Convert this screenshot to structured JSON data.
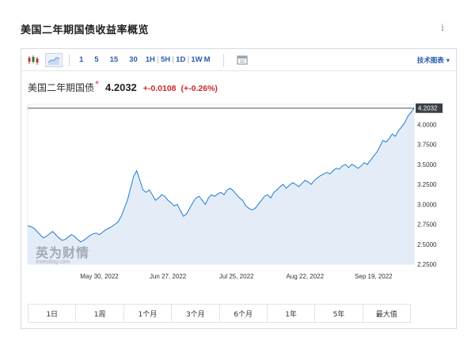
{
  "page": {
    "title": "美国二年期国债收益率概览"
  },
  "toolbar": {
    "intervals": [
      "1",
      "5",
      "15",
      "30",
      "1H",
      "5H",
      "1D",
      "1W",
      "M"
    ],
    "tech_chart_label": "技术图表 ▾"
  },
  "quote": {
    "name": "美国二年期国债",
    "star": "*",
    "price": "4.2032",
    "change": "+-0.0108",
    "change_pct": "(+-0.26%)"
  },
  "watermark": {
    "big": "英为财情",
    "small": "Investing.com"
  },
  "ranges": [
    "1日",
    "1周",
    "1个月",
    "3个月",
    "6个月",
    "1年",
    "5年",
    "最大值"
  ],
  "colors": {
    "line": "#1f7bd1",
    "area": "#e4edf7",
    "down": "#d0282a",
    "link": "#2a5db0"
  },
  "chart_data": {
    "type": "area",
    "title": "",
    "xlabel": "",
    "ylabel": "",
    "ylim": [
      2.25,
      4.25
    ],
    "yticks": [
      2.25,
      2.5,
      2.75,
      3.0,
      3.25,
      3.5,
      3.75,
      4.0
    ],
    "ytick_labels": [
      "2.2500",
      "2.5000",
      "2.7500",
      "3.0000",
      "3.2500",
      "3.5000",
      "3.7500",
      "4.0000"
    ],
    "xticks": [
      {
        "label": "May 30, 2022",
        "index": 23
      },
      {
        "label": "Jun 27, 2022",
        "index": 45
      },
      {
        "label": "Jul 25, 2022",
        "index": 67
      },
      {
        "label": "Aug 22, 2022",
        "index": 89
      },
      {
        "label": "Sep 19, 2022",
        "index": 111
      }
    ],
    "last_value_label": "4.2032",
    "reference_line": 4.2032,
    "values": [
      2.73,
      2.72,
      2.7,
      2.66,
      2.62,
      2.58,
      2.6,
      2.63,
      2.66,
      2.62,
      2.58,
      2.55,
      2.56,
      2.59,
      2.62,
      2.6,
      2.56,
      2.53,
      2.55,
      2.58,
      2.61,
      2.63,
      2.64,
      2.62,
      2.65,
      2.68,
      2.7,
      2.72,
      2.75,
      2.78,
      2.85,
      2.95,
      3.05,
      3.2,
      3.35,
      3.42,
      3.3,
      3.18,
      3.15,
      3.18,
      3.12,
      3.05,
      3.08,
      3.12,
      3.1,
      3.05,
      3.02,
      2.98,
      3.0,
      2.92,
      2.85,
      2.88,
      2.95,
      3.02,
      3.08,
      3.1,
      3.05,
      3.0,
      3.08,
      3.12,
      3.1,
      3.13,
      3.15,
      3.12,
      3.18,
      3.2,
      3.17,
      3.12,
      3.08,
      3.05,
      2.98,
      2.95,
      2.93,
      2.95,
      3.0,
      3.05,
      3.1,
      3.12,
      3.08,
      3.15,
      3.18,
      3.22,
      3.25,
      3.2,
      3.24,
      3.27,
      3.25,
      3.22,
      3.26,
      3.3,
      3.28,
      3.25,
      3.3,
      3.33,
      3.36,
      3.38,
      3.4,
      3.38,
      3.42,
      3.45,
      3.44,
      3.48,
      3.5,
      3.46,
      3.5,
      3.48,
      3.45,
      3.48,
      3.52,
      3.5,
      3.55,
      3.6,
      3.65,
      3.72,
      3.8,
      3.78,
      3.82,
      3.88,
      3.85,
      3.92,
      3.97,
      4.02,
      4.1,
      4.15,
      4.2032
    ]
  }
}
